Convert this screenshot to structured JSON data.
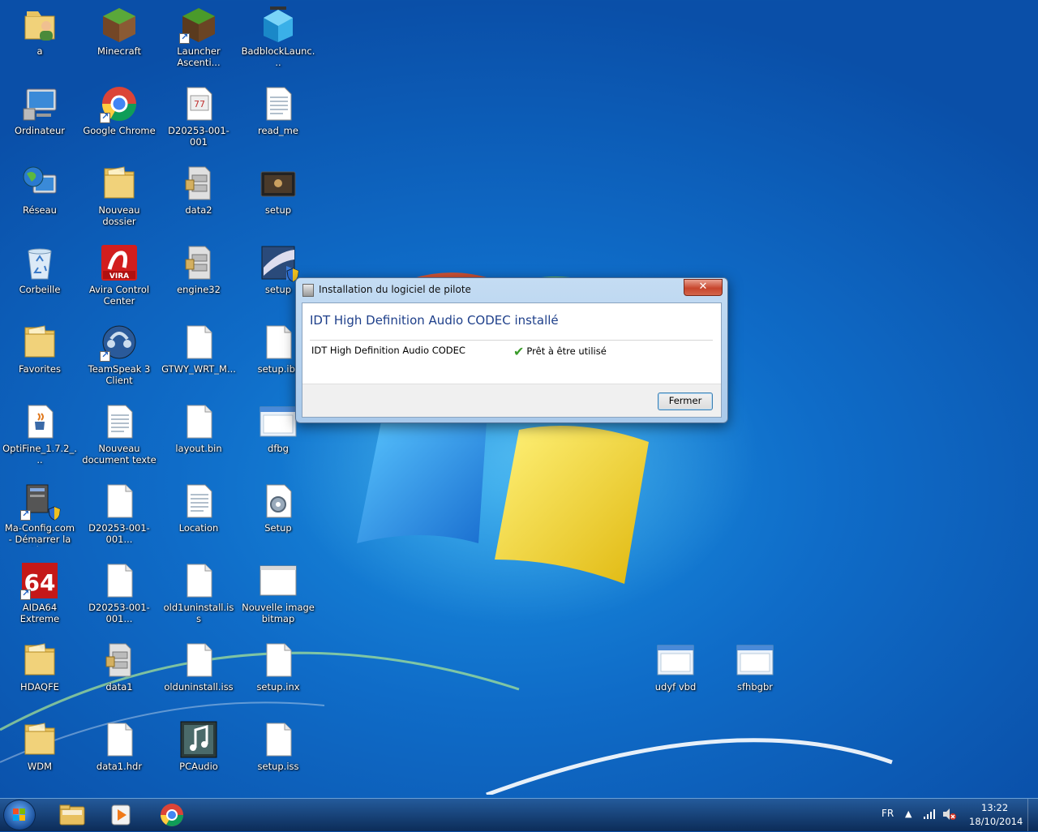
{
  "desktop": {
    "icons": [
      {
        "label": "a",
        "icon": "user-folder-icon"
      },
      {
        "label": "Minecraft",
        "icon": "minecraft-icon"
      },
      {
        "label": "Launcher Ascenti...",
        "icon": "minecraft-launcher-icon"
      },
      {
        "label": "BadblockLaunc...",
        "icon": "cube-launcher-icon"
      },
      {
        "label": "Ordinateur",
        "icon": "computer-icon"
      },
      {
        "label": "Google Chrome",
        "icon": "chrome-icon"
      },
      {
        "label": "D20253-001-001",
        "icon": "calendar-file-icon"
      },
      {
        "label": "read_me",
        "icon": "text-file-icon"
      },
      {
        "label": "Réseau",
        "icon": "network-icon"
      },
      {
        "label": "Nouveau dossier",
        "icon": "folder-icon"
      },
      {
        "label": "data2",
        "icon": "cabinet-file-icon"
      },
      {
        "label": "setup",
        "icon": "setup-app-icon"
      },
      {
        "label": "Corbeille",
        "icon": "recycle-bin-icon"
      },
      {
        "label": "Avira Control Center",
        "icon": "avira-icon"
      },
      {
        "label": "engine32",
        "icon": "cabinet-file-icon"
      },
      {
        "label": "setup",
        "icon": "installer-icon"
      },
      {
        "label": "Favorites",
        "icon": "folder-icon"
      },
      {
        "label": "TeamSpeak 3 Client",
        "icon": "teamspeak-icon"
      },
      {
        "label": "GTWY_WRT_M...",
        "icon": "blank-file-icon"
      },
      {
        "label": "setup.ibt",
        "icon": "blank-file-icon"
      },
      {
        "label": "OptiFine_1.7.2_...",
        "icon": "java-file-icon"
      },
      {
        "label": "Nouveau document texte",
        "icon": "text-file-icon"
      },
      {
        "label": "layout.bin",
        "icon": "blank-file-icon"
      },
      {
        "label": "dfbg",
        "icon": "window-app-icon"
      },
      {
        "label": "Ma-Config.com - Démarrer la dét...",
        "icon": "config-app-icon"
      },
      {
        "label": "D20253-001-001...",
        "icon": "blank-file-icon"
      },
      {
        "label": "Location",
        "icon": "text-file-icon"
      },
      {
        "label": "Setup",
        "icon": "gear-file-icon"
      },
      {
        "label": "AIDA64 Extreme",
        "icon": "aida64-icon"
      },
      {
        "label": "D20253-001-001...",
        "icon": "blank-file-icon"
      },
      {
        "label": "old1uninstall.iss",
        "icon": "blank-file-icon"
      },
      {
        "label": "Nouvelle image bitmap",
        "icon": "bitmap-file-icon"
      },
      {
        "label": "HDAQFE",
        "icon": "folder-icon"
      },
      {
        "label": "data1",
        "icon": "cabinet-file-icon"
      },
      {
        "label": "olduninstall.iss",
        "icon": "blank-file-icon"
      },
      {
        "label": "setup.inx",
        "icon": "blank-file-icon"
      },
      {
        "label": "WDM",
        "icon": "folder-icon"
      },
      {
        "label": "data1.hdr",
        "icon": "blank-file-icon"
      },
      {
        "label": "PCAudio",
        "icon": "music-app-icon"
      },
      {
        "label": "setup.iss",
        "icon": "blank-file-icon"
      },
      {
        "label": "udyf vbd",
        "icon": "window-app-icon"
      },
      {
        "label": "sfhbgbr",
        "icon": "window-app-icon"
      }
    ]
  },
  "dialog": {
    "title": "Installation du logiciel de pilote",
    "close_label": "✕",
    "heading": "IDT High Definition Audio CODEC installé",
    "device_name": "IDT High Definition Audio CODEC",
    "status": "Prêt à être utilisé",
    "close_button_label": "Fermer"
  },
  "taskbar": {
    "pinned": [
      {
        "name": "explorer",
        "icon": "folder-icon"
      },
      {
        "name": "media-player",
        "icon": "media-player-icon"
      },
      {
        "name": "chrome",
        "icon": "chrome-icon"
      }
    ],
    "tray": {
      "language": "FR",
      "time": "13:22",
      "date": "18/10/2014"
    }
  }
}
